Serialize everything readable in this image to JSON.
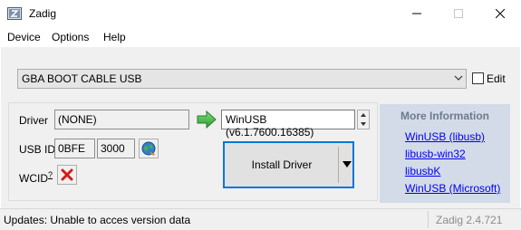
{
  "window": {
    "title": "Zadig",
    "icon": "zadig-app-icon"
  },
  "menu": {
    "items": [
      "Device",
      "Options",
      "Help"
    ]
  },
  "device": {
    "selected": "GBA BOOT CABLE USB",
    "edit_label": "Edit",
    "edit_checked": false
  },
  "driver": {
    "label": "Driver",
    "current": "(NONE)",
    "target": "WinUSB (v6.1.7600.16385)",
    "arrow_color": "#3cb043"
  },
  "usb_id": {
    "label": "USB ID",
    "vid": "0BFE",
    "pid": "3000"
  },
  "wcid": {
    "label": "WCID",
    "superscript": "?",
    "status_icon": "red-x-icon",
    "status_color": "#d71a1a"
  },
  "install": {
    "label": "Install Driver"
  },
  "info": {
    "title": "More Information",
    "links": [
      "WinUSB (libusb)",
      "libusb-win32",
      "libusbK",
      "WinUSB (Microsoft)"
    ],
    "background": "#d3dbe9"
  },
  "status": {
    "message": "Updates: Unable to acces version data",
    "version": "Zadig 2.4.721"
  },
  "colors": {
    "accent": "#0078d7",
    "link": "#0000ee"
  }
}
